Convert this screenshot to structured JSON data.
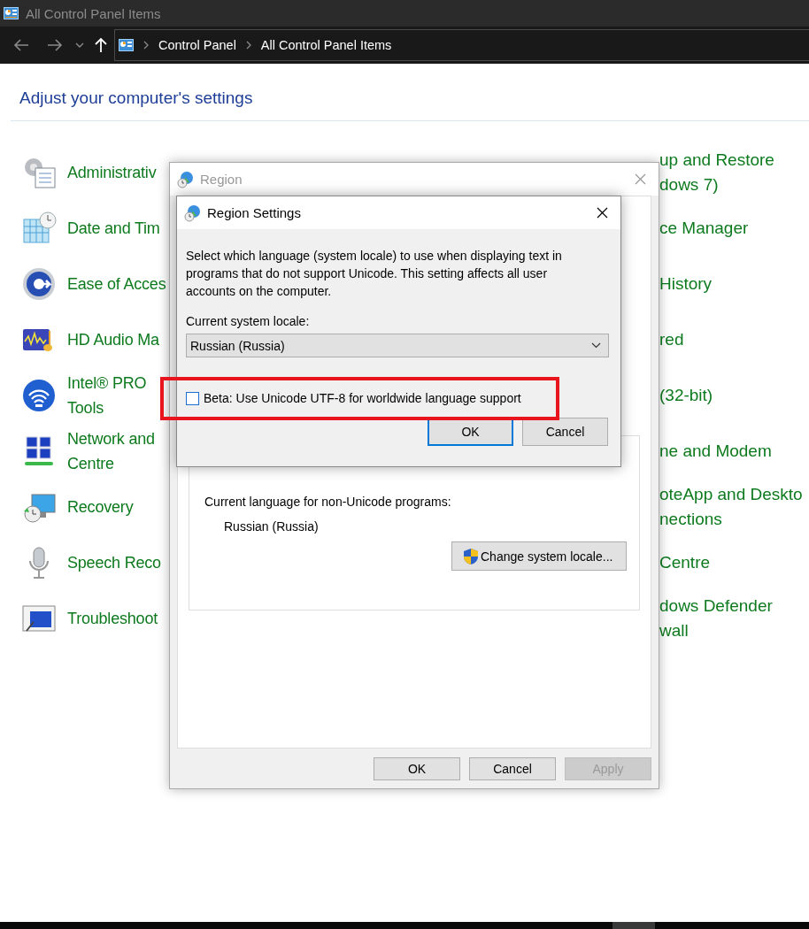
{
  "window": {
    "title": "All Control Panel Items"
  },
  "breadcrumb": [
    "Control Panel",
    "All Control Panel Items"
  ],
  "heading": "Adjust your computer's settings",
  "items_left": [
    {
      "lines": [
        "Administrativ"
      ]
    },
    {
      "lines": [
        "Date and Tim"
      ]
    },
    {
      "lines": [
        "Ease of Acces"
      ]
    },
    {
      "lines": [
        "HD Audio Ma"
      ]
    },
    {
      "lines": [
        "Intel® PRO",
        "Tools"
      ]
    },
    {
      "lines": [
        "Network and",
        "Centre"
      ]
    },
    {
      "lines": [
        "Recovery"
      ]
    },
    {
      "lines": [
        "Speech Reco"
      ]
    },
    {
      "lines": [
        "Troubleshoot"
      ]
    }
  ],
  "items_right": [
    {
      "lines": [
        "up and Restore",
        "dows 7)"
      ]
    },
    {
      "lines": [
        "ce Manager"
      ]
    },
    {
      "lines": [
        "History"
      ]
    },
    {
      "lines": [
        "red"
      ]
    },
    {
      "lines": [
        "(32-bit)"
      ]
    },
    {
      "lines": [
        "ne and Modem"
      ]
    },
    {
      "lines": [
        "oteApp and Deskto",
        "nections"
      ]
    },
    {
      "lines": [
        "Centre"
      ]
    },
    {
      "lines": [
        "dows Defender",
        "wall"
      ]
    }
  ],
  "region_dialog": {
    "title": "Region",
    "active": false,
    "group": {
      "label": "Current language for non-Unicode programs:",
      "value": "Russian (Russia)",
      "button": "Change system locale..."
    },
    "buttons": [
      {
        "label": "OK",
        "disabled": false
      },
      {
        "label": "Cancel",
        "disabled": false
      },
      {
        "label": "Apply",
        "disabled": true
      }
    ]
  },
  "settings_dialog": {
    "title": "Region Settings",
    "active": true,
    "description": "Select which language (system locale) to use when displaying text in programs that do not support Unicode. This setting affects all user accounts on the computer.",
    "locale_label": "Current system locale:",
    "locale": "Russian (Russia)",
    "utf8_option": {
      "label": "Beta: Use Unicode UTF-8 for worldwide language support",
      "checked": false
    },
    "buttons": [
      {
        "label": "OK",
        "default": true
      },
      {
        "label": "Cancel",
        "default": false
      }
    ]
  }
}
